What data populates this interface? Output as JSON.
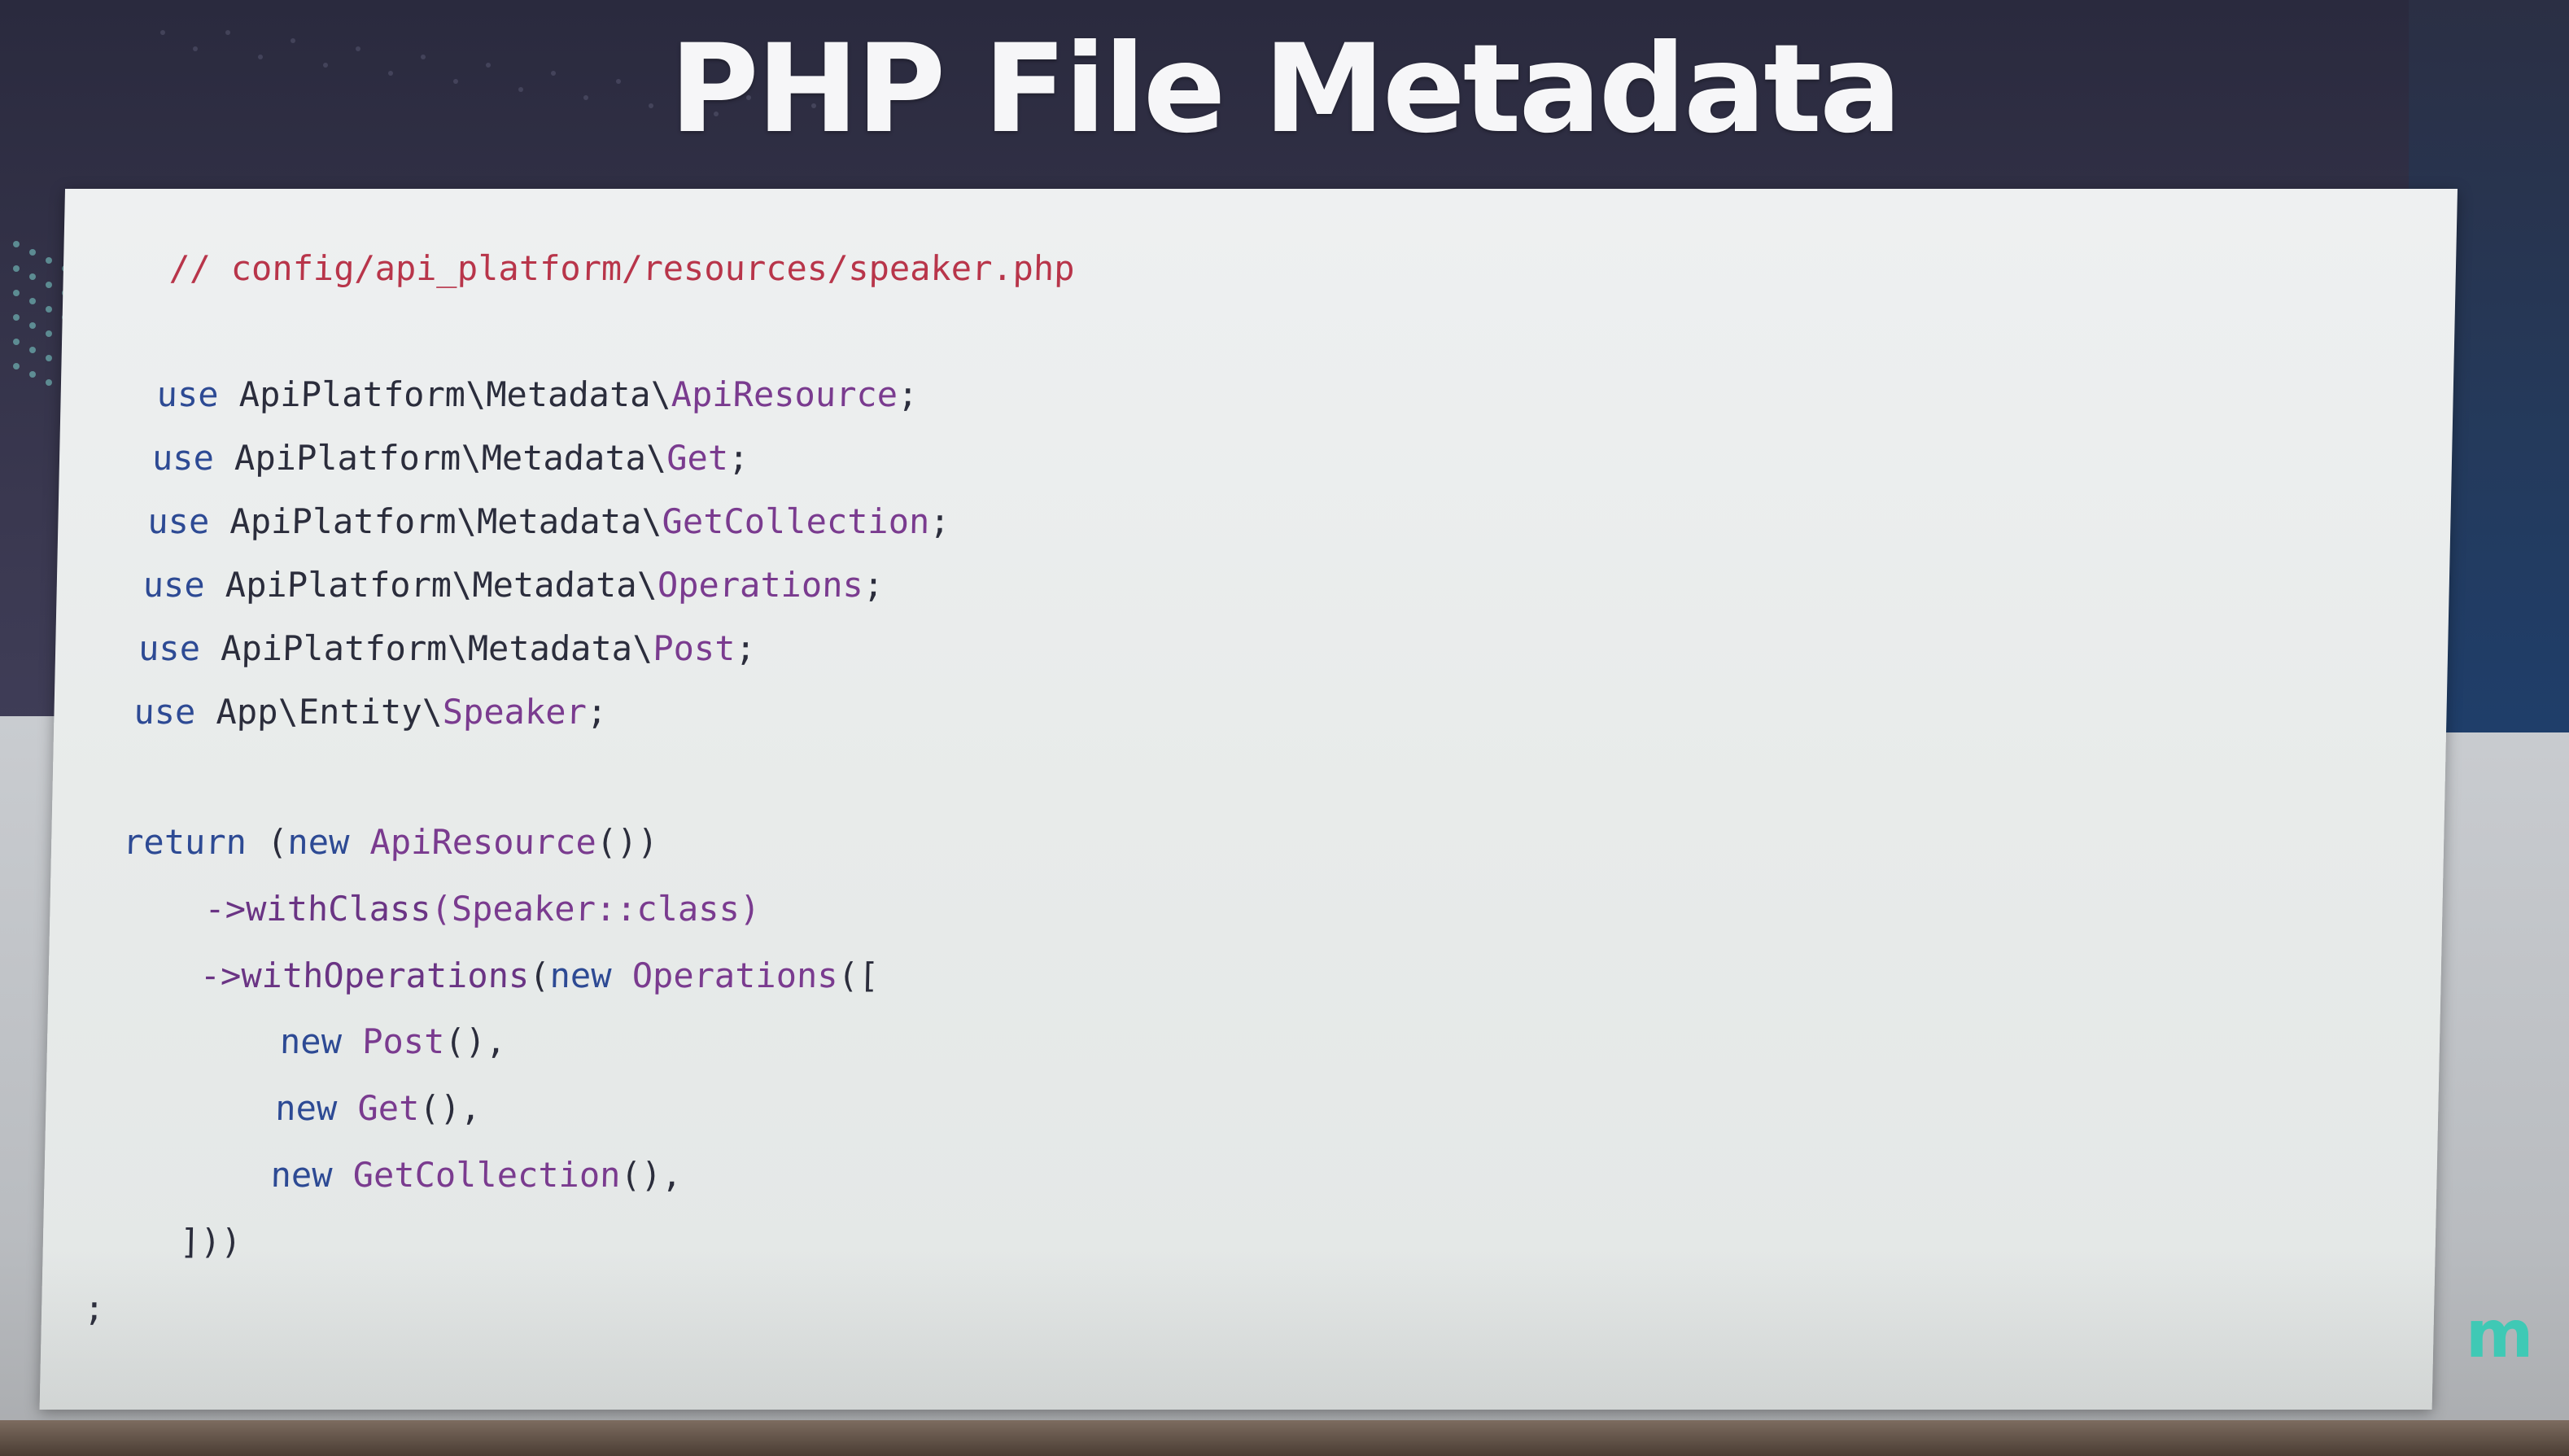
{
  "slide": {
    "title": "PHP File Metadata"
  },
  "code": {
    "comment": "// config/api_platform/resources/speaker.php",
    "use_kw": "use",
    "uses": [
      {
        "ns": "ApiPlatform\\Metadata\\",
        "cls": "ApiResource",
        "end": ";"
      },
      {
        "ns": "ApiPlatform\\Metadata\\",
        "cls": "Get",
        "end": ";"
      },
      {
        "ns": "ApiPlatform\\Metadata\\",
        "cls": "GetCollection",
        "end": ";"
      },
      {
        "ns": "ApiPlatform\\Metadata\\",
        "cls": "Operations",
        "end": ";"
      },
      {
        "ns": "ApiPlatform\\Metadata\\",
        "cls": "Post",
        "end": ";"
      },
      {
        "ns": "App\\Entity\\",
        "cls": "Speaker",
        "end": ";"
      }
    ],
    "return_kw": "return",
    "return_open": " (",
    "new_kw": "new",
    "api_resource": "ApiResource",
    "return_close": "())",
    "arrow1": "->",
    "with_class": "withClass",
    "with_class_arg": "(Speaker::class)",
    "arrow2": "->",
    "with_ops": "withOperations",
    "with_ops_open": "(",
    "operations": "Operations",
    "ops_bracket": "([",
    "items": [
      {
        "cls": "Post",
        "end": "(),"
      },
      {
        "cls": "Get",
        "end": "(),"
      },
      {
        "cls": "GetCollection",
        "end": "(),"
      }
    ],
    "close": "]))",
    "semicolon": ";"
  },
  "logo": {
    "text": "m"
  },
  "colors": {
    "comment": "#b8354a",
    "keyword": "#2d4a94",
    "class": "#7a3b8f",
    "title": "#f6f6f8",
    "logo": "#3fc9b5"
  }
}
